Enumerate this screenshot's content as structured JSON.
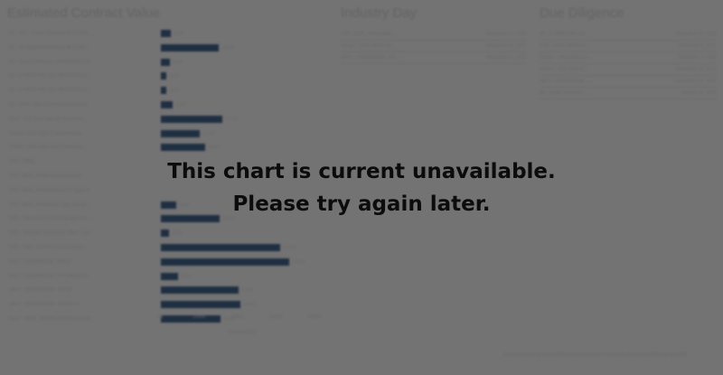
{
  "panels": {
    "contract_value": {
      "title": "Estimated Contract Value"
    },
    "industry_day": {
      "title": "Industry Day"
    },
    "due_diligence": {
      "title": "Due Diligence"
    }
  },
  "chart_data": {
    "type": "bar",
    "orientation": "horizontal",
    "title": "",
    "categories": [
      "AF - AFC - Cyber Contracts (AFCYBER...",
      "AF - AF Materiel Command, AF ECAS...",
      "AF - Cyber Contracts - LEGYBER/GSTE...",
      "AF - CYBERCOM, USCYBERCOM Cy...",
      "AF - CYBERCOM, USCYBERCOM CY...",
      "AF - DISA - Special Mission Awareness",
      "Army - U.S. Army Special Operations ...",
      "Civilian - DOJ, DEA IT Infrastructure",
      "Civilian - Information and Technology ...",
      "DOE - ORNL",
      "DOE - EPAL, NNSA Sandia's Award",
      "DOE - EPAL, NNSA Western IT Support",
      "DOE - EPAL, NNSA Plan, Ops, and An...",
      "DOE - Office of the Chief Management ...",
      "DOE - Strategic Capabilities Office - Cor...",
      "DOE - DISA - ANAPS 2.0 Recompete",
      "NAVY - USASPACOM, JANDS",
      "NAVY - USASPACOM - PRO/MISSION",
      "NAVY - USASPACOM - UPGM",
      "NAVY - USASPACOM - NAVSLAN",
      "Navy - USMC - MCPAG C4ISR Integrate..."
    ],
    "values": [
      5500,
      32000,
      5000,
      3000,
      3000,
      6500,
      34000,
      21500,
      24500,
      0,
      0,
      0,
      8500,
      32500,
      4500,
      66000,
      71000,
      9500,
      43000,
      44000,
      33000
    ],
    "value_labels": [
      "5,500",
      "32,000",
      "5,000",
      "3,000",
      "3,000",
      "6,500",
      "34,000",
      "21,500",
      "24,500",
      "",
      "",
      "",
      "8,500",
      "32,500",
      "4,500",
      "66,000",
      "71,000",
      "9,500",
      "43,000",
      "44,000",
      "33,000"
    ],
    "x_ticks": [
      "0K",
      "20000",
      "40000",
      "60000",
      "80000"
    ],
    "xlim": [
      0,
      85000
    ],
    "xlabel": "Rounded ECV",
    "bar_color": "#3f5f86"
  },
  "industry_day": {
    "rows": [
      {
        "name": "DOE - EPAL, NNSA Wate...",
        "date": "November 17, 2023"
      },
      {
        "name": "Civilian - DOJ, DEA IT Inf...",
        "date": "December 15, 2023"
      },
      {
        "name": "NAVY - USASPACOM - UP...",
        "date": "November 15, 2023"
      }
    ]
  },
  "due_diligence": {
    "rows": [
      {
        "name": "AF - CYBERCOM, US...",
        "date": "November 16, 2023"
      },
      {
        "name": "DOE - EPAL, NNSA W...",
        "date": "December 5, 2023"
      },
      {
        "name": "Civilian - Information an...",
        "date": "November 7, 2023"
      },
      {
        "name": "Civilian - DOJ, DEA IT...",
        "date": "December 14, 2023"
      },
      {
        "name": "NAVY - USASPACOM - ...",
        "date": "November 17, 2023"
      },
      {
        "name": "AF - Cyber Contracts -...",
        "date": "January 10, 2024"
      }
    ]
  },
  "footnote": "All Industry Day and Due Diligence sessions will be held virtually unless otherwise specified",
  "overlay": {
    "line1": "This chart is current unavailable.",
    "line2": "Please try again later."
  }
}
